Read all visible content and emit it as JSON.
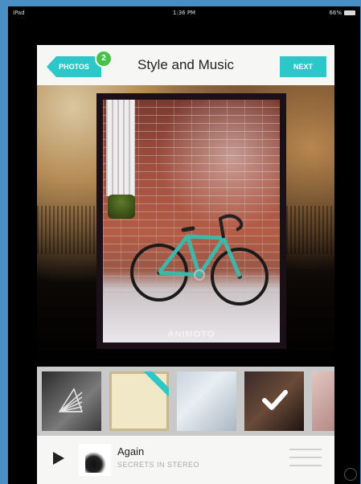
{
  "status_bar": {
    "carrier": "iPad",
    "time": "1:36 PM",
    "battery": "66%"
  },
  "header": {
    "back_label": "PHOTOS",
    "badge_count": "2",
    "title": "Style and Music",
    "next_label": "NEXT"
  },
  "preview": {
    "watermark": "ANIMOTO"
  },
  "styles": [
    {
      "name": "style-1",
      "icon": "triangle-icon"
    },
    {
      "name": "style-2",
      "icon": "ribbon"
    },
    {
      "name": "style-3"
    },
    {
      "name": "style-4",
      "selected": true,
      "icon": "check-icon"
    },
    {
      "name": "style-5"
    }
  ],
  "player": {
    "song_title": "Again",
    "artist": "SECRETS IN STEREO"
  },
  "accent_color": "#2ec7c9",
  "badge_color": "#45c24a"
}
